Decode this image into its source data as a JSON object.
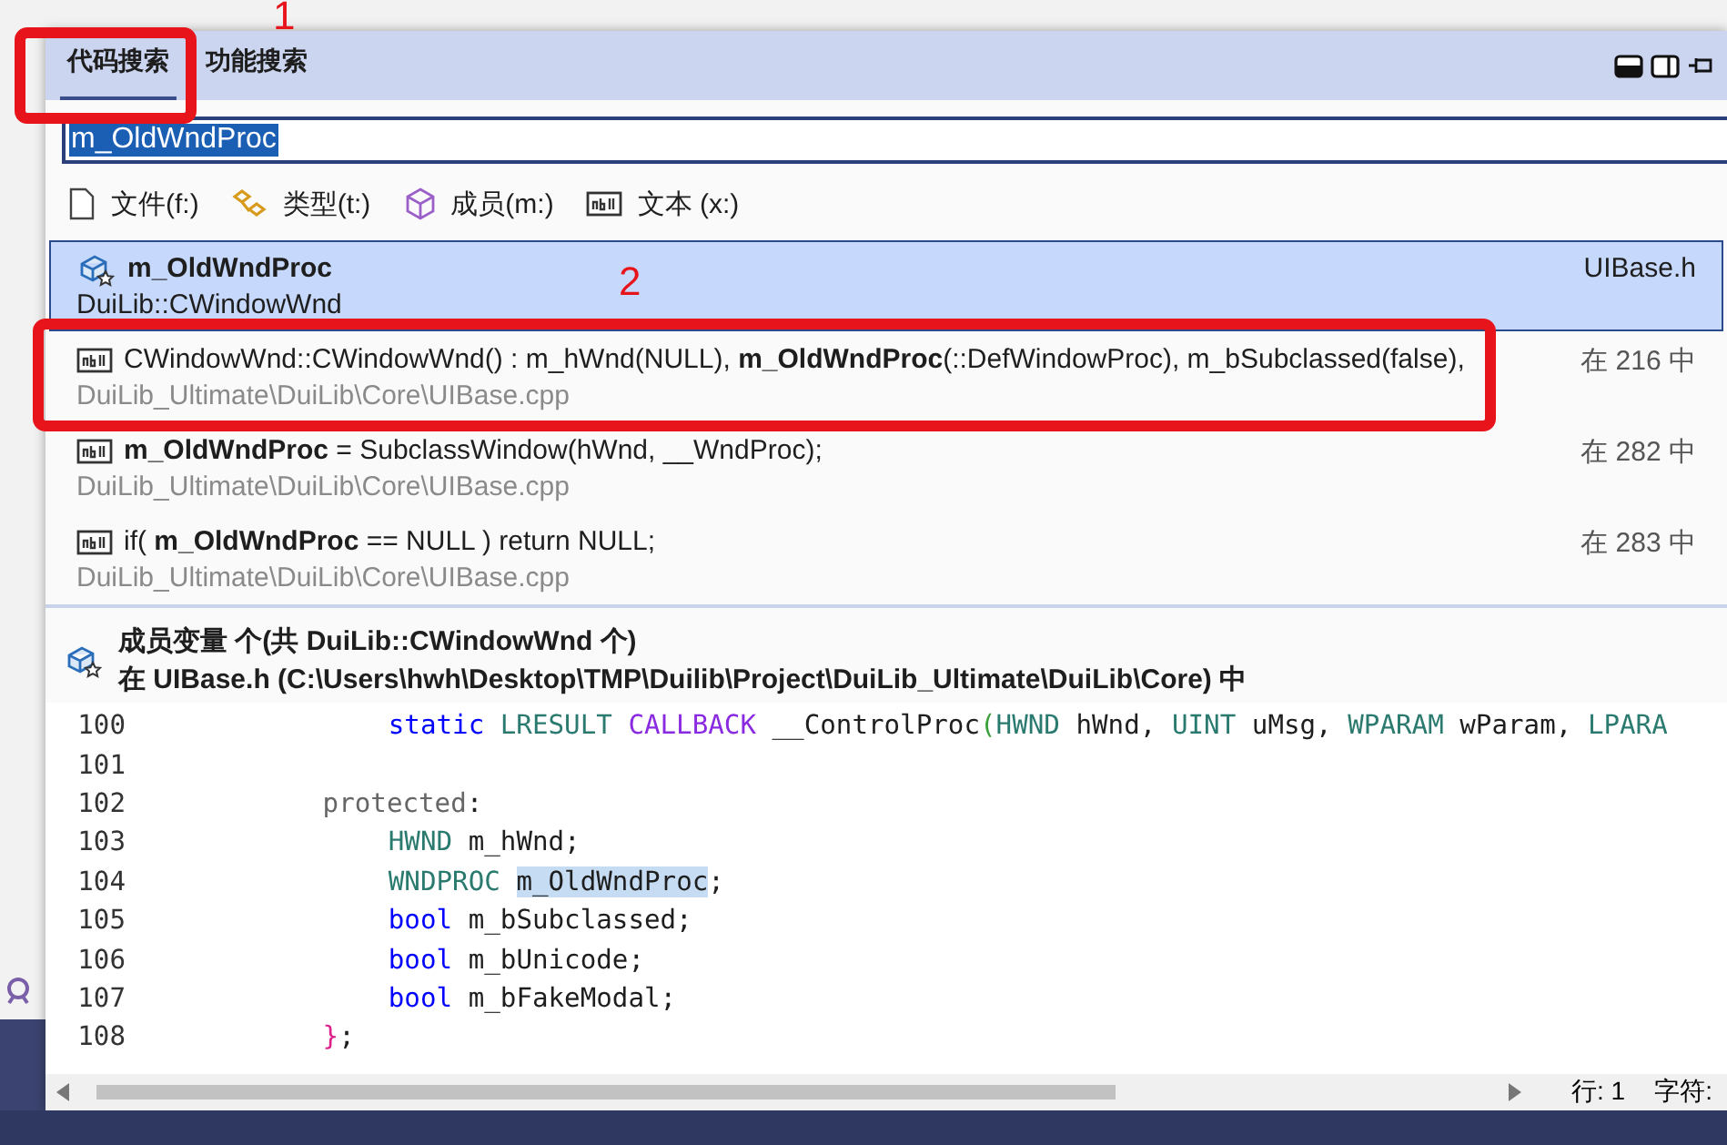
{
  "tabs": [
    {
      "label": "代码搜索",
      "selected": true
    },
    {
      "label": "功能搜索",
      "selected": false
    }
  ],
  "search": {
    "value": "m_OldWndProc"
  },
  "filters": [
    {
      "kind": "file",
      "label": "文件(f:)"
    },
    {
      "kind": "type",
      "label": "类型(t:)"
    },
    {
      "kind": "member",
      "label": "成员(m:)"
    },
    {
      "kind": "text",
      "label": "文本 (x:)"
    }
  ],
  "results": [
    {
      "kind": "member",
      "title": "m_OldWndProc",
      "subtitle": "DuiLib::CWindowWnd",
      "location": "UIBase.h",
      "selected": true
    },
    {
      "kind": "text",
      "title": "CWindowWnd::CWindowWnd() : m_hWnd(NULL), **m_OldWndProc**(::DefWindowProc), m_bSubclassed(false),",
      "subtitle": "DuiLib_Ultimate\\DuiLib\\Core\\UIBase.cpp",
      "location": "在 216 中",
      "selected": false
    },
    {
      "kind": "text",
      "title": "**m_OldWndProc** = SubclassWindow(hWnd, __WndProc);",
      "subtitle": "DuiLib_Ultimate\\DuiLib\\Core\\UIBase.cpp",
      "location": "在 282 中",
      "selected": false
    },
    {
      "kind": "text",
      "title": "if( **m_OldWndProc** == NULL ) return NULL;",
      "subtitle": "DuiLib_Ultimate\\DuiLib\\Core\\UIBase.cpp",
      "location": "在 283 中",
      "selected": false
    }
  ],
  "detail": {
    "summary": "成员变量 个(共 DuiLib::CWindowWnd 个)",
    "location": "在 UIBase.h (C:\\Users\\hwh\\Desktop\\TMP\\Duilib\\Project\\DuiLib_Ultimate\\DuiLib\\Core) 中"
  },
  "code": [
    {
      "number": "100",
      "kind": "member",
      "tokens": [
        {
          "kind": "keyword",
          "text": "static"
        },
        {
          "kind": "type",
          "text": " LRESULT"
        },
        {
          "kind": "macro",
          "text": " CALLBACK"
        },
        {
          "kind": "plain",
          "text": " __ControlProc"
        },
        {
          "kind": "paren",
          "text": "("
        },
        {
          "kind": "type",
          "text": "HWND"
        },
        {
          "kind": "plain",
          "text": " hWnd, "
        },
        {
          "kind": "type",
          "text": "UINT"
        },
        {
          "kind": "plain",
          "text": " uMsg, "
        },
        {
          "kind": "type",
          "text": "WPARAM"
        },
        {
          "kind": "plain",
          "text": " wParam, "
        },
        {
          "kind": "type",
          "text": "LPARA"
        }
      ]
    },
    {
      "number": "101",
      "kind": "blank"
    },
    {
      "number": "102",
      "kind": "section",
      "tokens": [
        {
          "kind": "access",
          "text": "protected"
        },
        {
          "kind": "plain",
          "text": ":"
        }
      ]
    },
    {
      "number": "103",
      "kind": "member",
      "tokens": [
        {
          "kind": "type",
          "text": "HWND"
        },
        {
          "kind": "plain",
          "text": " m_hWnd;"
        }
      ]
    },
    {
      "number": "104",
      "kind": "member",
      "tokens": [
        {
          "kind": "type",
          "text": "WNDPROC"
        },
        {
          "kind": "match",
          "text": " m_OldWndProc"
        },
        {
          "kind": "plain",
          "text": ";"
        }
      ]
    },
    {
      "number": "105",
      "kind": "member",
      "tokens": [
        {
          "kind": "keyword",
          "text": "bool"
        },
        {
          "kind": "plain",
          "text": " m_bSubclassed;"
        }
      ]
    },
    {
      "number": "106",
      "kind": "member",
      "tokens": [
        {
          "kind": "keyword",
          "text": "bool"
        },
        {
          "kind": "plain",
          "text": " m_bUnicode;"
        }
      ]
    },
    {
      "number": "107",
      "kind": "member",
      "tokens": [
        {
          "kind": "keyword",
          "text": "bool"
        },
        {
          "kind": "plain",
          "text": " m_bFakeModal;"
        }
      ]
    },
    {
      "number": "108",
      "kind": "section",
      "tokens": [
        {
          "kind": "brace",
          "text": "}"
        },
        {
          "kind": "plain",
          "text": ";"
        }
      ]
    }
  ],
  "status": {
    "line": "行: 1",
    "column": "字符:"
  },
  "annotations": [
    {
      "label": "1"
    },
    {
      "label": "2"
    }
  ]
}
